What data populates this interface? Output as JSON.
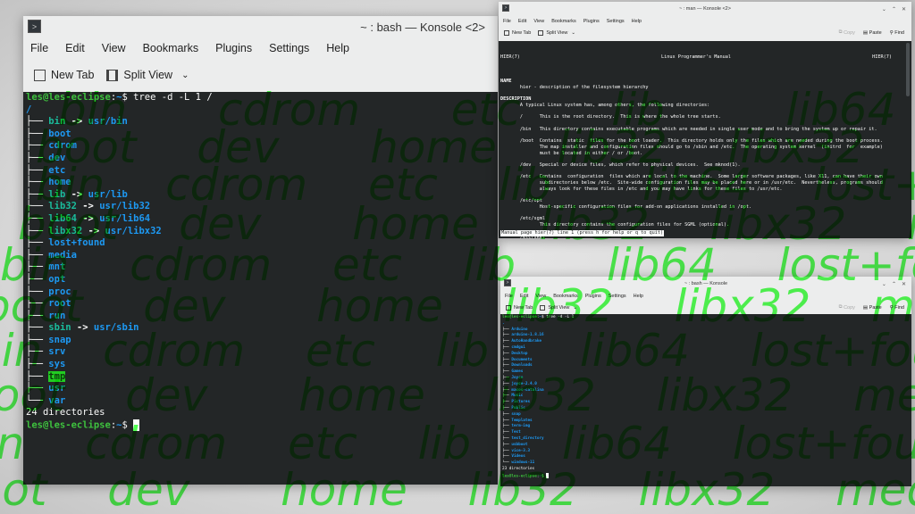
{
  "wallpaper": {
    "rows": [
      "bin   cdrom   etc   lib    lib64   lost+found",
      "boot  dev   home  lib32  libx32  media",
      "bin  cdrom  etc  lib   lib64  lost+found",
      "boot  dev   home  lib32  libx32  media",
      "bin  cdrom  etc  lib   lib64  lost+found",
      "boot  dev   home  lib32  libx32  media",
      "bin  cdrom  etc  lib   lib64  lost+found",
      "boot  dev   home  lib32  libx32  media",
      "bin  cdrom  etc  lib   lib64  lost+found",
      "boot  dev   home  lib32  libx32  media"
    ]
  },
  "menu": [
    "File",
    "Edit",
    "View",
    "Bookmarks",
    "Plugins",
    "Settings",
    "Help"
  ],
  "toolbar": {
    "new_tab": "New Tab",
    "split_view": "Split View",
    "copy": "Copy",
    "paste": "Paste",
    "find": "Find"
  },
  "left_window": {
    "title": "~ : bash — Konsole <2>",
    "prompt_user": "les@les-eclipse",
    "prompt_colon": ":",
    "prompt_path": "~",
    "prompt_sign": "$ ",
    "command": "tree -d -L 1 /",
    "root": "/",
    "entries": [
      {
        "name": "bin",
        "target": "usr/bin"
      },
      {
        "name": "boot"
      },
      {
        "name": "cdrom"
      },
      {
        "name": "dev"
      },
      {
        "name": "etc"
      },
      {
        "name": "home"
      },
      {
        "name": "lib",
        "target": "usr/lib"
      },
      {
        "name": "lib32",
        "target": "usr/lib32"
      },
      {
        "name": "lib64",
        "target": "usr/lib64"
      },
      {
        "name": "libx32",
        "target": "usr/libx32"
      },
      {
        "name": "lost+found"
      },
      {
        "name": "media"
      },
      {
        "name": "mnt"
      },
      {
        "name": "opt"
      },
      {
        "name": "proc"
      },
      {
        "name": "root"
      },
      {
        "name": "run"
      },
      {
        "name": "sbin",
        "target": "usr/sbin"
      },
      {
        "name": "snap"
      },
      {
        "name": "srv"
      },
      {
        "name": "sys"
      },
      {
        "name": "tmp",
        "highlight": true
      },
      {
        "name": "usr"
      },
      {
        "name": "var"
      }
    ],
    "summary": "24 directories"
  },
  "man_window": {
    "title": "~ : man — Konsole <2>",
    "header_left": "HIER(7)",
    "header_center": "Linux Programmer's Manual",
    "header_right": "HIER(7)",
    "lines": [
      "",
      "NAME",
      "       hier - description of the filesystem hierarchy",
      "",
      "DESCRIPTION",
      "       A typical Linux system has, among others, the following directories:",
      "",
      "       /      This is the root directory.  This is where the whole tree starts.",
      "",
      "       /bin   This directory contains executable programs which are needed in single user mode and to bring the system up or repair it.",
      "",
      "       /boot  Contains  static  files for the boot loader.  This directory holds only the files which are needed during the boot process.",
      "              The map installer and configuration files should go to /sbin and /etc.  The operating system kernel  (initrd  for  example)",
      "              must be located in either / or /boot.",
      "",
      "       /dev   Special or device files, which refer to physical devices.  See mknod(1).",
      "",
      "       /etc   Contains  configuration  files which are local to the machine.  Some larger software packages, like X11, can have their own",
      "              subdirectories below /etc.  Site-wide configuration files may be placed here or in /usr/etc.  Nevertheless, programs should",
      "              always look for these files in /etc and you may have links for these files to /usr/etc.",
      "",
      "       /etc/opt",
      "              Host-specific configuration files for add-on applications installed in /opt.",
      "",
      "       /etc/sgml",
      "              This directory contains the configuration files for SGML (optional).",
      "",
      "       /etc/skel",
      "              When a new user account is created, files from this directory are usually copied into the user's home directory.",
      ""
    ],
    "status": "Manual page hier(7) line 1 (press h for help or q to quit)"
  },
  "bottom_window": {
    "title": "~ : bash — Konsole",
    "command": "tree -d -L 1",
    "root": ".",
    "entries": [
      "Arduino",
      "arduino-1.8.16",
      "AutoHandbrake",
      "cmdgui",
      "Desktop",
      "Documents",
      "Downloads",
      "Games",
      "Joyce",
      "joyce-2.4.0",
      "macos-catalina",
      "Music",
      "Pictures",
      "Public",
      "snap",
      "Templates",
      "term-img",
      "Test",
      "test_directory",
      "usbboot",
      "vice-3.3",
      "Videos",
      "windows-11"
    ],
    "summary": "23 directories"
  }
}
